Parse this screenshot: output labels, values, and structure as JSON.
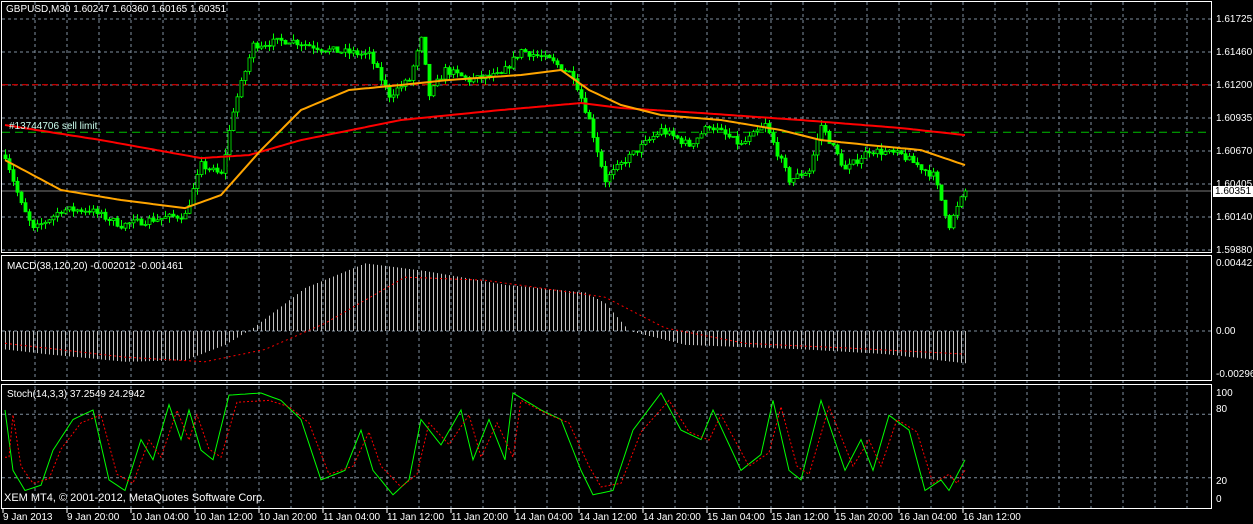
{
  "header": {
    "title": "GBPUSD,M30  1.60247 1.60360 1.60165 1.60351"
  },
  "order_label": "#13744706 sell limit",
  "macd": {
    "title": "MACD(38,120,20) -0.002012 -0.001461",
    "axis": [
      "0.004421",
      "0.00",
      "-0.00296"
    ]
  },
  "stoch": {
    "title": "Stoch(14,3,3) 37.2549 24.2942",
    "axis": [
      "100",
      "80",
      "20",
      "0"
    ]
  },
  "copyright": "XEM MT4, © 2001-2012, MetaQuotes Software Corp.",
  "price_axis": [
    "1.61725",
    "1.61460",
    "1.61200",
    "1.60935",
    "1.60670",
    "1.60405",
    "1.60140",
    "1.59880"
  ],
  "current_price": "1.60351",
  "time_axis": [
    "9 Jan 2013",
    "9 Jan 20:00",
    "10 Jan 04:00",
    "10 Jan 12:00",
    "10 Jan 20:00",
    "11 Jan 04:00",
    "11 Jan 12:00",
    "11 Jan 20:00",
    "14 Jan 04:00",
    "14 Jan 12:00",
    "14 Jan 20:00",
    "15 Jan 04:00",
    "15 Jan 12:00",
    "15 Jan 20:00",
    "16 Jan 04:00",
    "16 Jan 12:00"
  ],
  "colors": {
    "bull": "#00ff00",
    "ma_fast": "#ffa500",
    "ma_slow": "#ff0000",
    "sell_limit": "#00c000",
    "stop": "#ff0000",
    "grid": "#8090a0"
  },
  "chart_data": [
    {
      "type": "candlestick",
      "symbol": "GBPUSD",
      "timeframe": "M30",
      "bars": 241,
      "ylim": [
        1.5988,
        1.61725
      ],
      "close_anchors": [
        [
          0,
          1.60639
        ],
        [
          4,
          1.60239
        ],
        [
          7,
          1.6004
        ],
        [
          14,
          1.602
        ],
        [
          21,
          1.602
        ],
        [
          29,
          1.6008
        ],
        [
          36,
          1.6012
        ],
        [
          45,
          1.6016
        ],
        [
          49,
          1.60559
        ],
        [
          54,
          1.60479
        ],
        [
          57,
          1.61
        ],
        [
          62,
          1.61517
        ],
        [
          71,
          1.61557
        ],
        [
          81,
          1.61477
        ],
        [
          91,
          1.61437
        ],
        [
          96,
          1.61118
        ],
        [
          101,
          1.61238
        ],
        [
          104,
          1.61557
        ],
        [
          106,
          1.61118
        ],
        [
          110,
          1.61318
        ],
        [
          116,
          1.61238
        ],
        [
          124,
          1.61278
        ],
        [
          129,
          1.61477
        ],
        [
          136,
          1.61397
        ],
        [
          142,
          1.61278
        ],
        [
          146,
          1.60918
        ],
        [
          150,
          1.60439
        ],
        [
          155,
          1.60599
        ],
        [
          164,
          1.60838
        ],
        [
          171,
          1.60718
        ],
        [
          176,
          1.60878
        ],
        [
          184,
          1.60718
        ],
        [
          190,
          1.60878
        ],
        [
          196,
          1.60439
        ],
        [
          201,
          1.60519
        ],
        [
          204,
          1.60878
        ],
        [
          210,
          1.60519
        ],
        [
          216,
          1.60679
        ],
        [
          224,
          1.60639
        ],
        [
          232,
          1.60479
        ],
        [
          236,
          1.6008
        ],
        [
          240,
          1.60351
        ]
      ],
      "ma_fast": [
        [
          0,
          1.60598
        ],
        [
          14,
          1.60359
        ],
        [
          29,
          1.60279
        ],
        [
          45,
          1.60215
        ],
        [
          54,
          1.60319
        ],
        [
          64,
          1.60678
        ],
        [
          74,
          1.60998
        ],
        [
          86,
          1.61158
        ],
        [
          99,
          1.61198
        ],
        [
          111,
          1.61238
        ],
        [
          129,
          1.61278
        ],
        [
          139,
          1.61318
        ],
        [
          146,
          1.61158
        ],
        [
          154,
          1.61038
        ],
        [
          164,
          1.60958
        ],
        [
          179,
          1.60918
        ],
        [
          194,
          1.60838
        ],
        [
          204,
          1.60758
        ],
        [
          216,
          1.60718
        ],
        [
          229,
          1.60678
        ],
        [
          240,
          1.60558
        ]
      ],
      "ma_slow": [
        [
          0,
          1.60878
        ],
        [
          24,
          1.60758
        ],
        [
          49,
          1.60614
        ],
        [
          61,
          1.60638
        ],
        [
          74,
          1.60758
        ],
        [
          99,
          1.60918
        ],
        [
          124,
          1.60998
        ],
        [
          144,
          1.61054
        ],
        [
          154,
          1.61014
        ],
        [
          174,
          1.60974
        ],
        [
          199,
          1.60918
        ],
        [
          224,
          1.60854
        ],
        [
          240,
          1.60798
        ]
      ],
      "sell_limit": 1.6082,
      "stop_level": 1.612
    },
    {
      "type": "bar",
      "name": "MACD(38,120,20)",
      "ylim": [
        -0.00296,
        0.004421
      ],
      "main": [
        [
          0,
          -0.0012
        ],
        [
          10,
          -0.0015
        ],
        [
          30,
          -0.002
        ],
        [
          45,
          -0.0019
        ],
        [
          55,
          -0.0009
        ],
        [
          62,
          0.0002
        ],
        [
          75,
          0.0028
        ],
        [
          90,
          0.0044
        ],
        [
          105,
          0.0039
        ],
        [
          125,
          0.003
        ],
        [
          145,
          0.0025
        ],
        [
          150,
          0.0018
        ],
        [
          156,
          0
        ],
        [
          170,
          -0.0009
        ],
        [
          190,
          -0.0011
        ],
        [
          200,
          -0.0012
        ],
        [
          220,
          -0.0015
        ],
        [
          240,
          -0.0021
        ]
      ],
      "signal": [
        [
          0,
          -0.0008
        ],
        [
          30,
          -0.0017
        ],
        [
          50,
          -0.002
        ],
        [
          65,
          -0.0012
        ],
        [
          80,
          0.0005
        ],
        [
          100,
          0.0035
        ],
        [
          120,
          0.0033
        ],
        [
          150,
          0.0022
        ],
        [
          165,
          0.0002
        ],
        [
          185,
          -0.0008
        ],
        [
          210,
          -0.0011
        ],
        [
          240,
          -0.0015
        ]
      ]
    },
    {
      "type": "line",
      "name": "Stoch(14,3,3)",
      "ylim": [
        0,
        100
      ],
      "levels": [
        20,
        80
      ],
      "main": [
        [
          0,
          84
        ],
        [
          2,
          27
        ],
        [
          5,
          8
        ],
        [
          9,
          13
        ],
        [
          12,
          46
        ],
        [
          17,
          75
        ],
        [
          22,
          84
        ],
        [
          26,
          18
        ],
        [
          30,
          8
        ],
        [
          34,
          56
        ],
        [
          37,
          37
        ],
        [
          41,
          89
        ],
        [
          44,
          56
        ],
        [
          46,
          84
        ],
        [
          49,
          46
        ],
        [
          52,
          37
        ],
        [
          56,
          98
        ],
        [
          64,
          100
        ],
        [
          69,
          93
        ],
        [
          74,
          75
        ],
        [
          79,
          18
        ],
        [
          85,
          27
        ],
        [
          89,
          65
        ],
        [
          92,
          27
        ],
        [
          97,
          4
        ],
        [
          101,
          18
        ],
        [
          104,
          75
        ],
        [
          109,
          51
        ],
        [
          114,
          84
        ],
        [
          117,
          37
        ],
        [
          121,
          75
        ],
        [
          125,
          37
        ],
        [
          127,
          100
        ],
        [
          134,
          84
        ],
        [
          139,
          75
        ],
        [
          144,
          27
        ],
        [
          147,
          4
        ],
        [
          152,
          8
        ],
        [
          157,
          65
        ],
        [
          164,
          100
        ],
        [
          169,
          65
        ],
        [
          174,
          56
        ],
        [
          177,
          84
        ],
        [
          184,
          27
        ],
        [
          189,
          42
        ],
        [
          192,
          93
        ],
        [
          196,
          27
        ],
        [
          199,
          18
        ],
        [
          204,
          93
        ],
        [
          210,
          27
        ],
        [
          214,
          56
        ],
        [
          217,
          27
        ],
        [
          221,
          79
        ],
        [
          226,
          65
        ],
        [
          230,
          8
        ],
        [
          234,
          18
        ],
        [
          236,
          8
        ],
        [
          240,
          37
        ]
      ]
    }
  ]
}
